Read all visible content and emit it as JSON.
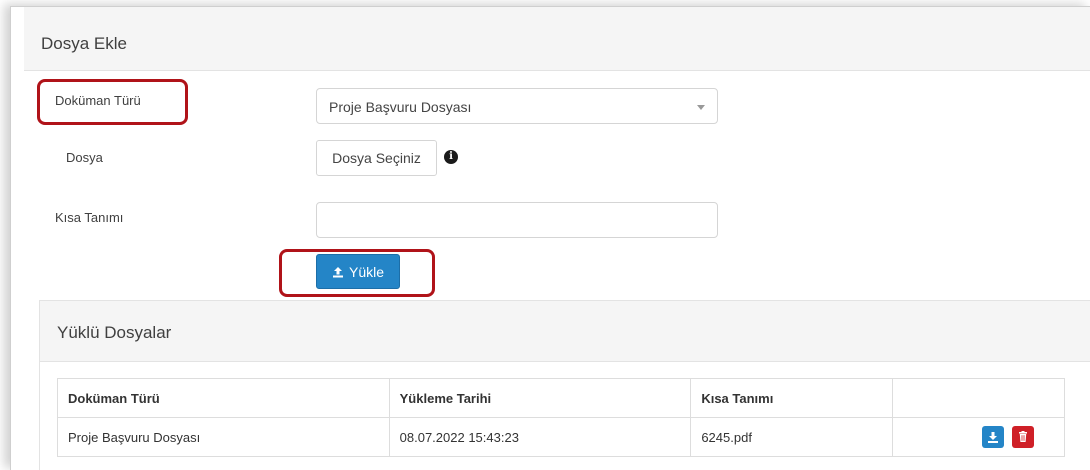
{
  "panel": {
    "title": "Dosya Ekle"
  },
  "form": {
    "doc_type_label": "Doküman Türü",
    "doc_type_value": "Proje Başvuru Dosyası",
    "file_label": "Dosya",
    "file_button": "Dosya Seçiniz",
    "desc_label": "Kısa Tanımı",
    "desc_value": "",
    "upload_button": "Yükle"
  },
  "uploaded": {
    "title": "Yüklü Dosyalar",
    "columns": [
      "Doküman Türü",
      "Yükleme Tarihi",
      "Kısa Tanımı",
      ""
    ],
    "rows": [
      {
        "doc_type": "Proje Başvuru Dosyası",
        "date": "08.07.2022 15:43:23",
        "desc": "6245.pdf"
      }
    ]
  },
  "colors": {
    "primary": "#2485c7",
    "danger": "#cf2027",
    "highlight": "#b01319"
  },
  "icons": [
    "chevron-down-icon",
    "info-icon",
    "upload-icon",
    "download-icon",
    "trash-icon"
  ]
}
